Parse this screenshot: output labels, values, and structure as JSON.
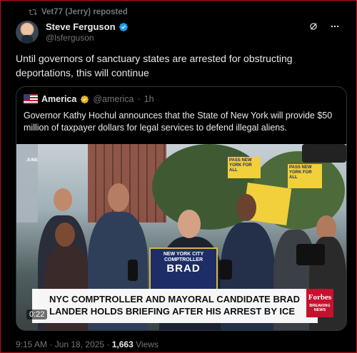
{
  "repost": {
    "text": "Vet77 (Jerry) reposted",
    "icon": "repost-icon"
  },
  "author": {
    "name": "Steve Ferguson",
    "handle": "@lsferguson",
    "verified_color": "#1d9bf0"
  },
  "top_actions": {
    "icons": [
      "grok-icon",
      "more-icon"
    ]
  },
  "tweet": {
    "text": "Until governors of sanctuary states are arrested for obstructing deportations, this will continue"
  },
  "quote": {
    "name": "America",
    "handle": "@america",
    "age": "1h",
    "badge_color": "#e2b719",
    "text": "Governor Kathy Hochul announces that the State of New York will provide $50 million of taxpayer dollars for legal services to defend illegal aliens.",
    "video": {
      "podium_line1": "NEW YORK CITY",
      "podium_line2": "COMPTROLLER",
      "podium_name": "BRAD",
      "banner": "NYC COMPTROLLER AND MAYORAL CANDIDATE BRAD LANDER HOLDS BRIEFING AFTER HIS ARREST BY ICE",
      "logo_name": "Forbes",
      "logo_tag": "BREAKING NEWS",
      "timer": "0:22",
      "sign_text": "PASS NEW YORK FOR ALL"
    }
  },
  "footer": {
    "time": "9:15 AM · Jun 18, 2025 · ",
    "views_count": "1,663",
    "views_label": " Views"
  }
}
